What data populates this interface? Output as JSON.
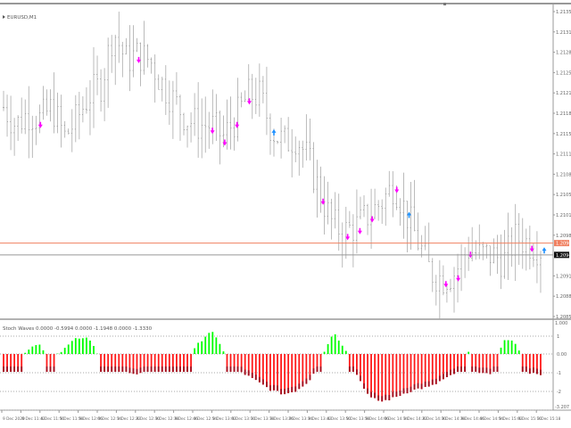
{
  "main": {
    "title": "EURUSD,M1",
    "price_min": 1.2084,
    "price_max": 1.2136,
    "price_labels": [
      "1.2135",
      "1.2131",
      "1.2128",
      "1.2125",
      "1.2121",
      "1.2118",
      "1.2115",
      "1.2111",
      "1.2108",
      "1.2105",
      "1.2101",
      "1.2098",
      "1.2095",
      "1.2091",
      "1.2088",
      "1.2085"
    ],
    "closes": [
      1.2119,
      1.2116,
      1.2118,
      1.2117,
      1.2119,
      1.2114,
      1.2117,
      1.2121,
      1.2123,
      1.2132,
      1.2127,
      1.2128,
      1.2127,
      1.2123,
      1.212,
      1.2117,
      1.2116,
      1.2116,
      1.2114,
      1.2117,
      1.2121,
      1.2121,
      1.2115,
      1.2113,
      1.2114,
      1.211,
      1.2104,
      1.2099,
      1.2098,
      1.2099,
      1.2101,
      1.2103,
      1.2106,
      1.2101,
      1.2096,
      1.2091,
      1.209,
      1.2091,
      1.2095,
      1.2094,
      1.2094,
      1.2093,
      1.2097,
      1.2096,
      1.2095
    ],
    "red_line": {
      "price": "1.2096",
      "color": "#f08060"
    },
    "bid_line": {
      "price": "1.2094",
      "color": "#999999"
    },
    "arrows_down": [
      3,
      11,
      17,
      18,
      19,
      20,
      26,
      28,
      29,
      30,
      32,
      36,
      37,
      38,
      43
    ],
    "arrows_up": [
      22,
      33,
      44
    ],
    "sell_color": "#ff00ff",
    "buy_color": "#1e90ff"
  },
  "indicator": {
    "title": "Stoch Waves 0.0000 -0.5994 0.0000 -1.1948 0.0000 -1.3330",
    "levels": [
      "1",
      "0.00",
      "-1",
      "-2"
    ],
    "top_label": "1.000",
    "bottom_label": "-3.207",
    "values": [
      -0.6,
      -0.5,
      0.3,
      0.5,
      -0.4,
      0.4,
      0.9,
      0.9,
      -0.3,
      -0.5,
      -0.9,
      -1.1,
      -0.8,
      -0.6,
      -1.0,
      -0.4,
      0.6,
      1.3,
      0.2,
      -0.8,
      -1.2,
      -1.6,
      -2.0,
      -2.2,
      -2.0,
      -1.5,
      -0.3,
      1.2,
      0.3,
      -1.2,
      -2.4,
      -2.6,
      -2.4,
      -2.1,
      -1.9,
      -1.8,
      -1.4,
      -1.1,
      0.2,
      -1.0,
      -1.2,
      0.8,
      0.6,
      -1.0,
      -1.2
    ],
    "pos_color": "#00ff00",
    "neg_color": "#ff1a1a"
  },
  "time_labels": [
    "9 Dec 2020",
    "9 Dec 11:42",
    "9 Dec 11:50",
    "9 Dec 11:58",
    "9 Dec 12:06",
    "9 Dec 12:14",
    "9 Dec 12:22",
    "9 Dec 12:30",
    "9 Dec 12:38",
    "9 Dec 12:46",
    "9 Dec 12:54",
    "9 Dec 13:02",
    "9 Dec 13:10",
    "9 Dec 13:18",
    "9 Dec 13:26",
    "9 Dec 13:34",
    "9 Dec 13:42",
    "9 Dec 13:50",
    "9 Dec 13:58",
    "9 Dec 14:06",
    "9 Dec 14:14",
    "9 Dec 14:22",
    "9 Dec 14:30",
    "9 Dec 14:38",
    "9 Dec 14:46",
    "9 Dec 14:54",
    "9 Dec 15:02",
    "9 Dec 15:10",
    "9 Dec 15:18"
  ]
}
